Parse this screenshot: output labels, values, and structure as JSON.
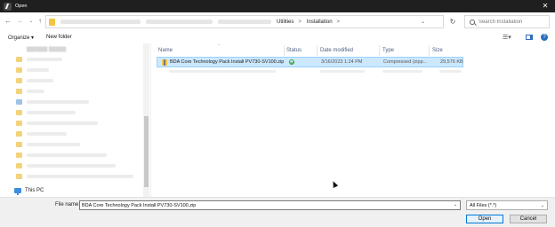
{
  "window": {
    "title": "Open"
  },
  "address": {
    "crumbs": [
      "Utilities",
      "Installation"
    ],
    "separator": ">",
    "search_placeholder": "Search Installation"
  },
  "toolbar": {
    "organize": "Organize ▾",
    "new_folder": "New folder"
  },
  "nav": {
    "this_pc": "This PC"
  },
  "columns": {
    "name": "Name",
    "status": "Status",
    "date": "Date modified",
    "type": "Type",
    "size": "Size"
  },
  "files": [
    {
      "name": "BDA Core Technology Pack Install PV730-SV100.zip",
      "date": "3/16/2023 1:24 PM",
      "type": "Compressed (zipp...",
      "size": "29,576 KB"
    }
  ],
  "footer": {
    "file_name_label": "File name:",
    "file_name_value": "BDA Core Technology Pack Install PV730-SV100.zip",
    "file_type": "All Files (*.*)",
    "open": "Open",
    "cancel": "Cancel"
  }
}
